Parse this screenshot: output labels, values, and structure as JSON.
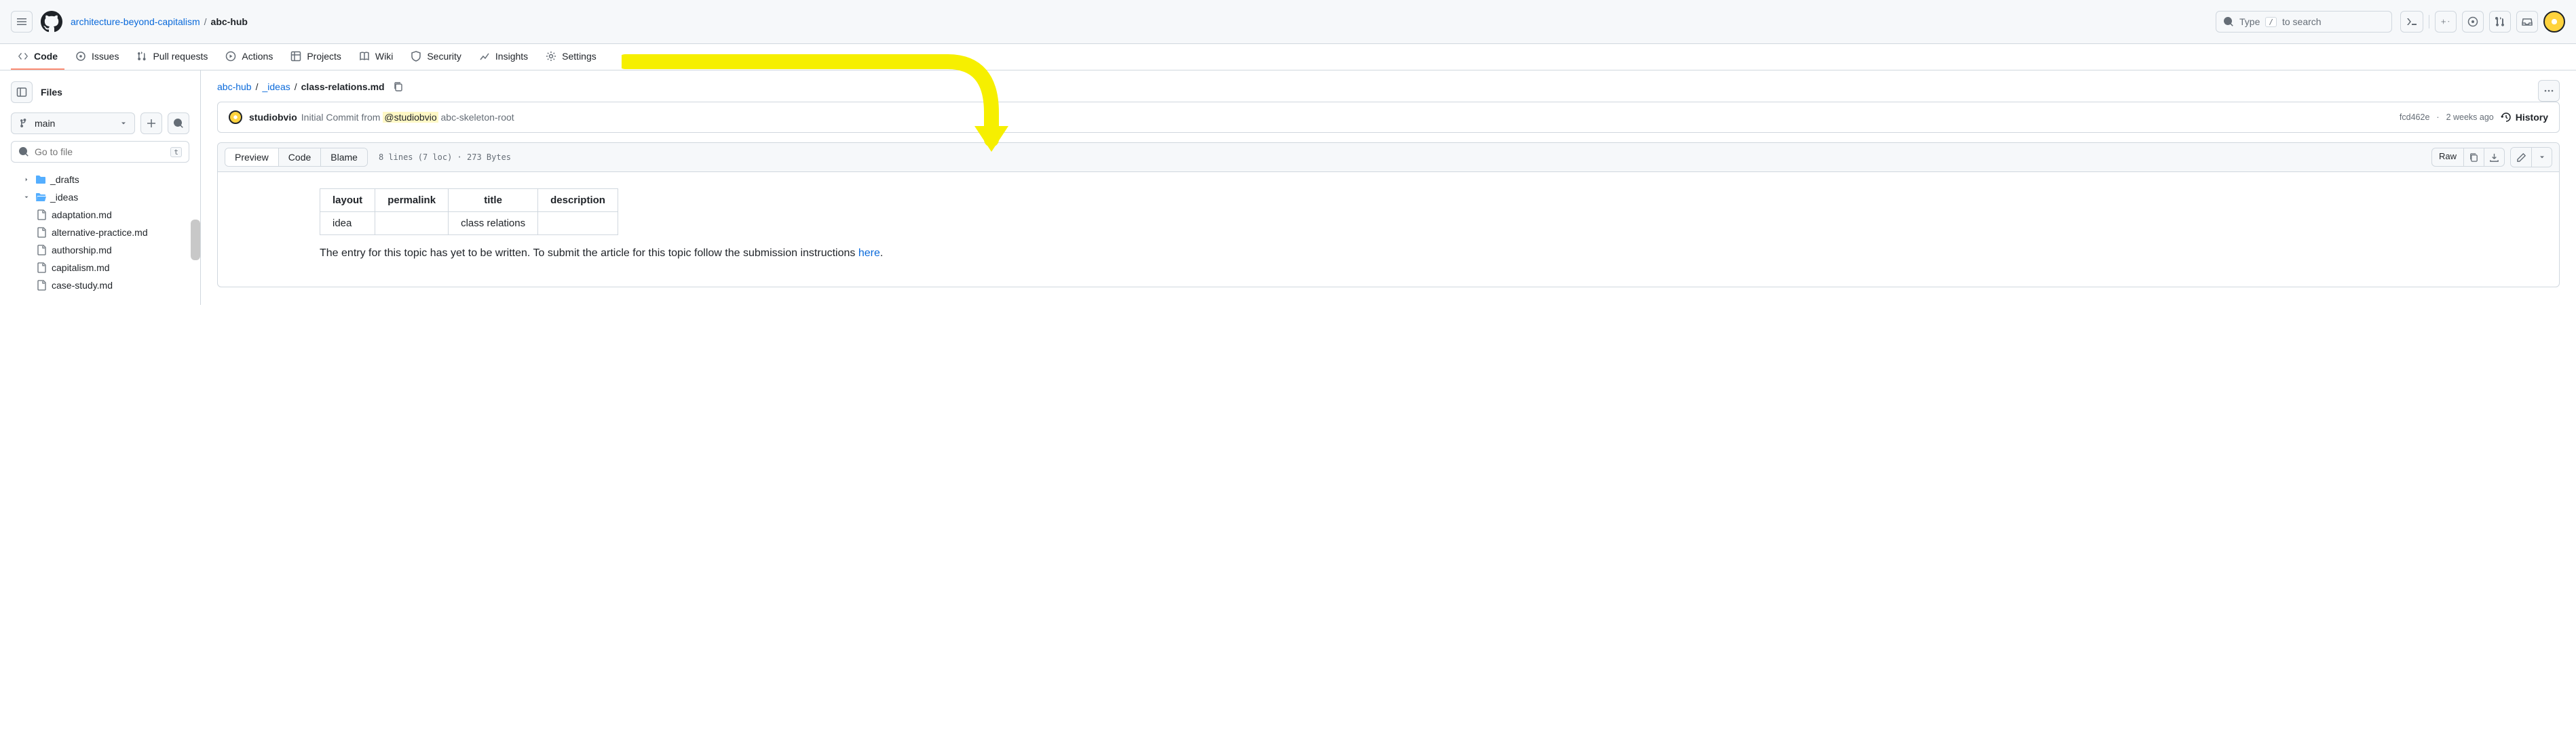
{
  "header": {
    "org": "architecture-beyond-capitalism",
    "repo": "abc-hub",
    "search_placeholder": "Type",
    "search_hint": "to search",
    "search_key": "/"
  },
  "nav": {
    "code": "Code",
    "issues": "Issues",
    "pulls": "Pull requests",
    "actions": "Actions",
    "projects": "Projects",
    "wiki": "Wiki",
    "security": "Security",
    "insights": "Insights",
    "settings": "Settings"
  },
  "sidebar": {
    "title": "Files",
    "branch": "main",
    "filter_placeholder": "Go to file",
    "filter_key": "t",
    "tree": {
      "drafts": "_drafts",
      "ideas": "_ideas",
      "files": [
        "adaptation.md",
        "alternative-practice.md",
        "authorship.md",
        "capitalism.md",
        "case-study.md"
      ]
    }
  },
  "path": {
    "root": "abc-hub",
    "dir": "_ideas",
    "file": "class-relations.md"
  },
  "commit": {
    "author": "studiobvio",
    "msg_pre": "Initial Commit from ",
    "mention": "@studiobvio",
    "msg_post": " abc-skeleton-root",
    "sha": "fcd462e",
    "when": "2 weeks ago",
    "history": "History"
  },
  "file": {
    "tabs": {
      "preview": "Preview",
      "code": "Code",
      "blame": "Blame"
    },
    "meta": "8 lines (7 loc) · 273 Bytes",
    "raw": "Raw"
  },
  "frontmatter": {
    "headers": [
      "layout",
      "permalink",
      "title",
      "description"
    ],
    "row": {
      "layout": "idea",
      "permalink": "",
      "title": "class relations",
      "description": ""
    }
  },
  "body": {
    "text": "The entry for this topic has yet to be written. To submit the article for this topic follow the submission instructions ",
    "link": "here",
    "period": "."
  }
}
